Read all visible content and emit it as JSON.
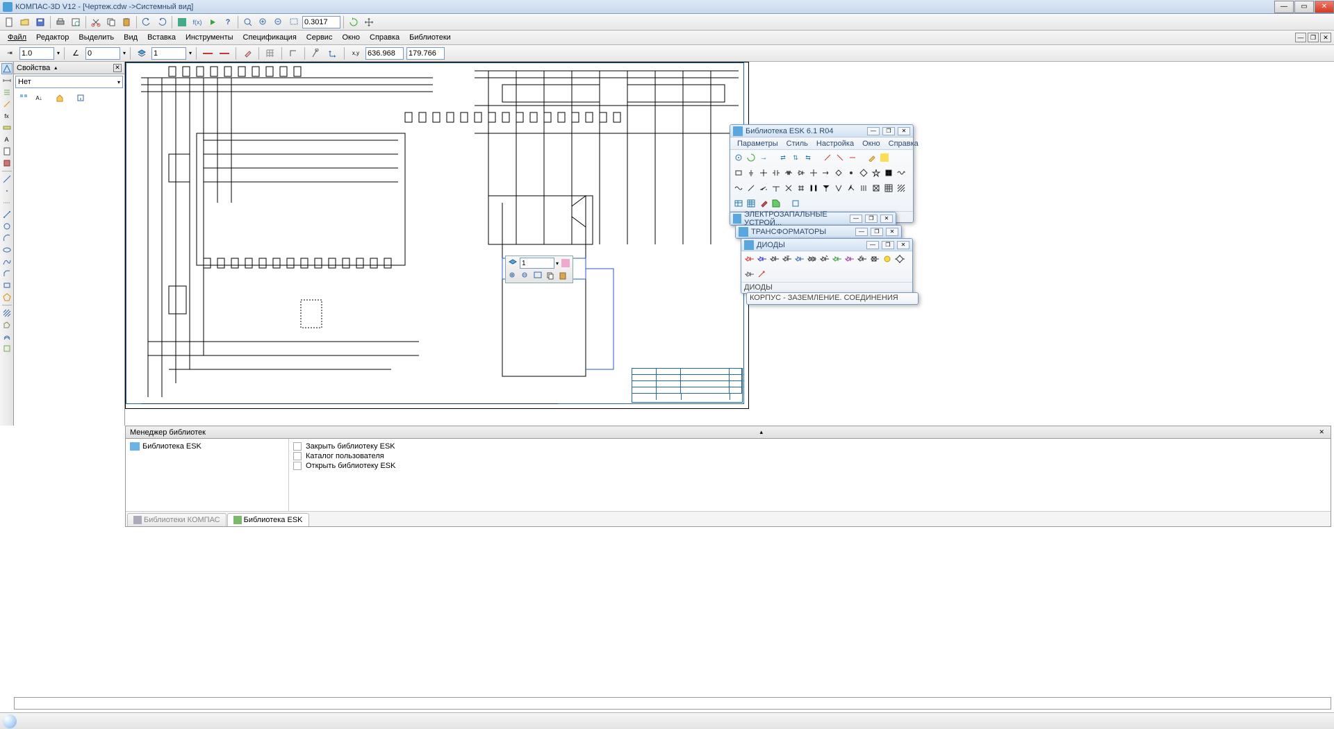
{
  "app": {
    "title": "КОМПАС-3D V12 - [Чертеж.cdw ->Системный вид]"
  },
  "topToolbar": {
    "zoom": "0.3017"
  },
  "menubar": {
    "items": [
      "Файл",
      "Редактор",
      "Выделить",
      "Вид",
      "Вставка",
      "Инструменты",
      "Спецификация",
      "Сервис",
      "Окно",
      "Справка",
      "Библиотеки"
    ]
  },
  "paramToolbar": {
    "field1": "1.0",
    "field2": "0",
    "field3": "1",
    "coordX": "636.968",
    "coordY": "179.766"
  },
  "propsPanel": {
    "title": "Свойства",
    "combo": "Нет"
  },
  "contextToolbar": {
    "value": "1"
  },
  "eskMain": {
    "title": "Библиотека ESK 6.1 R04",
    "menu": [
      "Параметры",
      "Стиль",
      "Настройка",
      "Окно",
      "Справка"
    ],
    "status": "Библиотека ESK 6.1 R04"
  },
  "eskPanel2": {
    "title": "ЭЛЕКТРОЗАПАЛЬНЫЕ УСТРОЙ..."
  },
  "eskPanel3": {
    "title": "ТРАНСФОРМАТОРЫ"
  },
  "eskPanel4": {
    "title": "ДИОДЫ",
    "status": "ДИОДЫ"
  },
  "eskPanel5": {
    "status": "КОРПУС - ЗАЗЕМЛЕНИЕ. СОЕДИНЕНИЯ"
  },
  "libMgr": {
    "title": "Менеджер библиотек",
    "treeItem": "Библиотека ESK",
    "listItems": [
      "Закрыть библиотеку ESK",
      "Каталог пользователя",
      "Открыть библиотеку ESK"
    ],
    "tabs": [
      "Библиотеки КОМПАС",
      "Библиотека ESK"
    ]
  }
}
